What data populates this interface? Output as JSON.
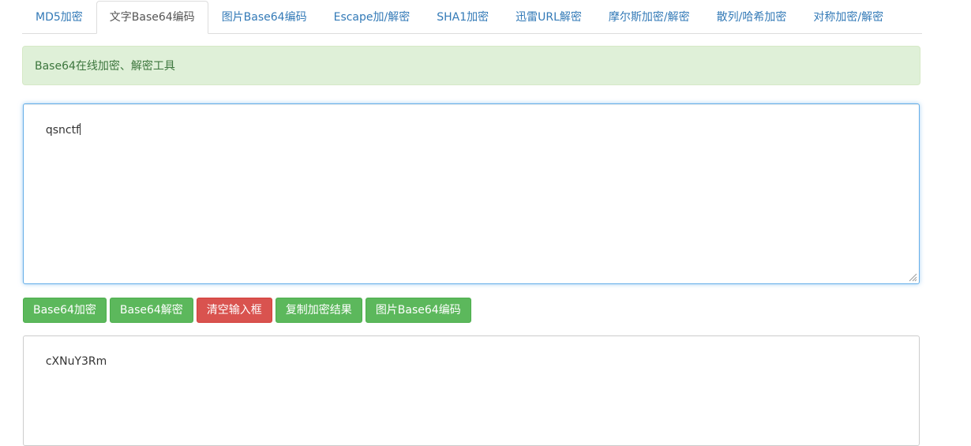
{
  "tabs": [
    {
      "label": "MD5加密"
    },
    {
      "label": "文字Base64编码",
      "active": true
    },
    {
      "label": "图片Base64编码"
    },
    {
      "label": "Escape加/解密"
    },
    {
      "label": "SHA1加密"
    },
    {
      "label": "迅雷URL解密"
    },
    {
      "label": "摩尔斯加密/解密"
    },
    {
      "label": "散列/哈希加密"
    },
    {
      "label": "对称加密/解密"
    }
  ],
  "alert": {
    "text": "Base64在线加密、解密工具"
  },
  "input": {
    "value": "qsnctf"
  },
  "buttons": {
    "encode": "Base64加密",
    "decode": "Base64解密",
    "clear": "清空输入框",
    "copy": "复制加密结果",
    "image": "图片Base64编码"
  },
  "output": {
    "value": "cXNuY3Rm"
  },
  "colors": {
    "link": "#337ab7",
    "success": "#5cb85c",
    "danger": "#d9534f",
    "alert_bg": "#dff0d8",
    "alert_text": "#3c763d",
    "focus_border": "#66afe9"
  }
}
